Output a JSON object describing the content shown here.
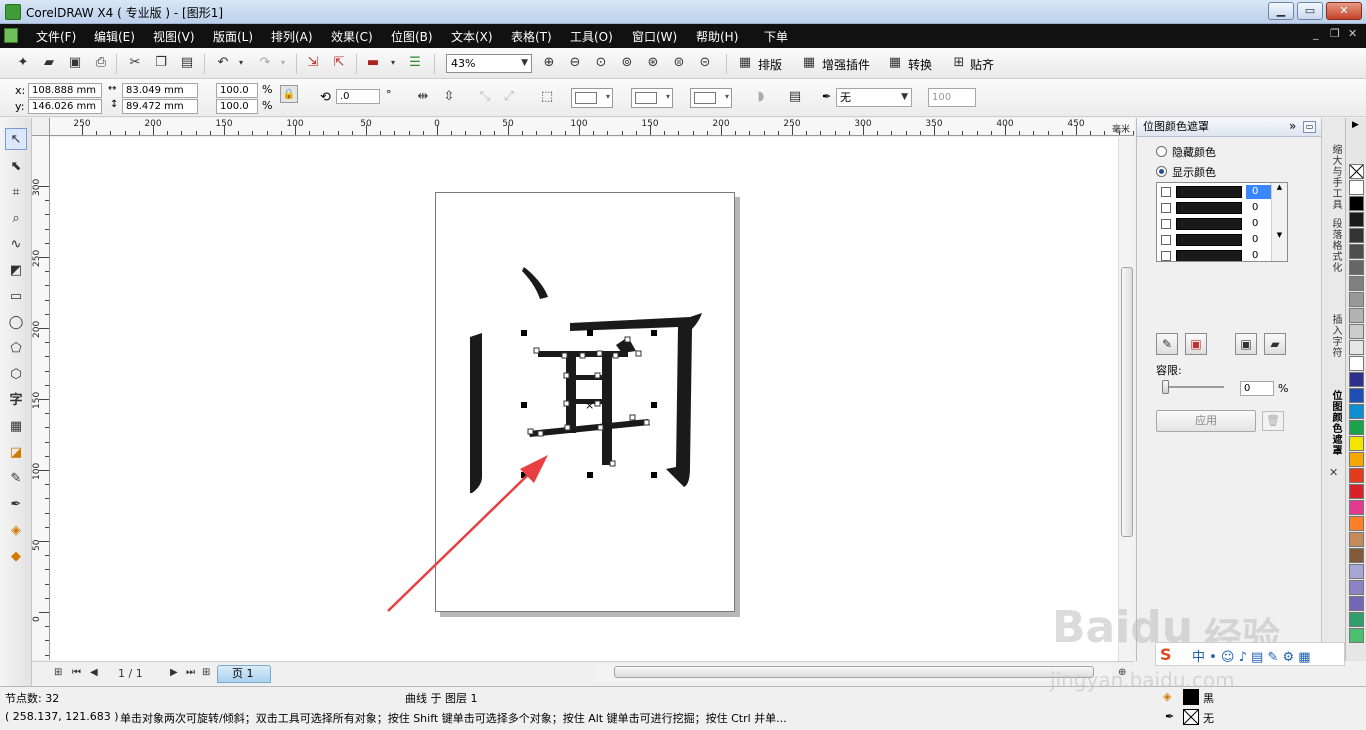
{
  "window": {
    "title": "CorelDRAW X4 ( 专业版 ) - [图形1]",
    "min_label": "▁",
    "max_label": "▭",
    "close_label": "✕"
  },
  "menu": {
    "items": [
      "文件(F)",
      "编辑(E)",
      "视图(V)",
      "版面(L)",
      "排列(A)",
      "效果(C)",
      "位图(B)",
      "文本(X)",
      "表格(T)",
      "工具(O)",
      "窗口(W)",
      "帮助(H)",
      "下单"
    ],
    "mdi_min": "_",
    "mdi_restore": "❐",
    "mdi_close": "✕"
  },
  "toolbar": {
    "zoom": "43%",
    "plugin_buttons": [
      "排版",
      "增强插件",
      "转换",
      "贴齐"
    ]
  },
  "propbar": {
    "x_label": "x:",
    "x_value": "108.888 mm",
    "y_label": "y:",
    "y_value": "146.026 mm",
    "w_value": "83.049 mm",
    "h_value": "89.472 mm",
    "scale_w": "100.0",
    "scale_h": "100.0",
    "percent": "%",
    "rotation": ".0",
    "degree": "°",
    "outline": "无",
    "opacity": "100"
  },
  "rulers": {
    "h_labels": [
      "250",
      "200",
      "150",
      "100",
      "50",
      "0",
      "50",
      "100",
      "150",
      "200",
      "250",
      "300",
      "350",
      "400",
      "450"
    ],
    "v_labels": [
      "300",
      "250",
      "200",
      "150",
      "100",
      "50",
      "0"
    ],
    "unit": "毫米"
  },
  "canvas": {
    "glyph": "闻"
  },
  "pagenav": {
    "counter": "1 / 1",
    "tab": "页 1"
  },
  "docker": {
    "title": "位图颜色遮罩",
    "radio_hide": "隐藏颜色",
    "radio_show": "显示颜色",
    "colors": [
      {
        "value": "0",
        "color": "#1a1a1a"
      },
      {
        "value": "0",
        "color": "#1a1a1a"
      },
      {
        "value": "0",
        "color": "#1a1a1a"
      },
      {
        "value": "0",
        "color": "#1a1a1a"
      },
      {
        "value": "0",
        "color": "#1a1a1a"
      }
    ],
    "tolerance_label": "容限:",
    "tolerance_value": "0",
    "tolerance_unit": "%",
    "apply": "应用"
  },
  "docker_tabs": [
    "缩大与手工具",
    "段落格式化",
    "插入字符",
    "位图颜色遮罩"
  ],
  "palette": {
    "colors": [
      "#ffffff",
      "#000000",
      "#1a1a1a",
      "#333333",
      "#4d4d4d",
      "#666666",
      "#808080",
      "#999999",
      "#b3b3b3",
      "#cccccc",
      "#e6e6e6",
      "#ffffff",
      "#2e2e8c",
      "#1f4fb5",
      "#0b8fd0",
      "#1aa44a",
      "#f2e600",
      "#f7a600",
      "#e33b1e",
      "#d8202a",
      "#e23a8e",
      "#ff7f27",
      "#c48a5a",
      "#7f5b3a",
      "#a7a7d7",
      "#8d82c4",
      "#7266b5",
      "#2f9f6b",
      "#4cbf6f"
    ]
  },
  "status": {
    "nodes": "节点数: 32",
    "object": "曲线 于 图层 1",
    "coords": "( 258.137, 121.683 )",
    "hint": "单击对象两次可旋转/倾斜；双击工具可选择所有对象；按住 Shift 键单击可选择多个对象；按住 Alt 键单击可进行挖掘；按住 Ctrl 并单...",
    "fill_label": "黑",
    "outline_label": "无"
  },
  "watermark": {
    "brand": "Baidu",
    "brand_cn": "经验",
    "url": "jingyan.baidu.com"
  }
}
